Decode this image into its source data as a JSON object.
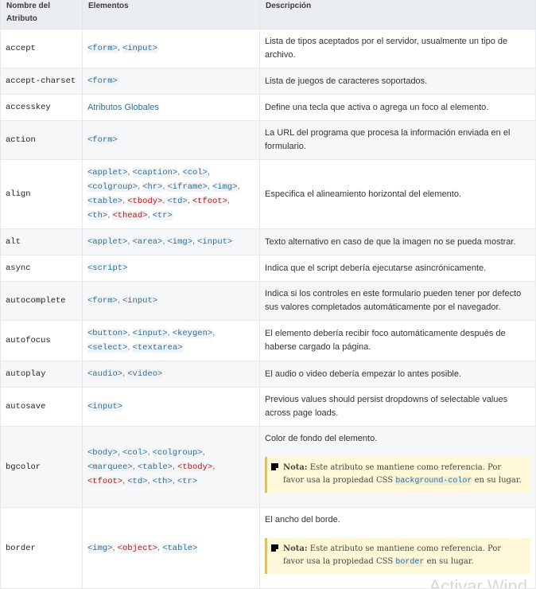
{
  "headers": [
    "Nombre del Atributo",
    "Elementos",
    "Descripción"
  ],
  "rows": [
    {
      "name": "accept",
      "elements": [
        {
          "text": "<form>"
        },
        {
          "text": "<input>"
        }
      ],
      "desc": "Lista de tipos aceptados por el servidor, usualmente un tipo de archivo."
    },
    {
      "name": "accept-charset",
      "elements": [
        {
          "text": "<form>"
        }
      ],
      "desc": "Lista de juegos de caracteres soportados."
    },
    {
      "name": "accesskey",
      "link": "Atributos Globales",
      "desc": "Define una tecla que activa o agrega un foco al elemento."
    },
    {
      "name": "action",
      "elements": [
        {
          "text": "<form>"
        }
      ],
      "desc": "La URL del programa que procesa la información enviada en el formulario."
    },
    {
      "name": "align",
      "elements": [
        {
          "text": "<applet>"
        },
        {
          "text": "<caption>"
        },
        {
          "text": "<col>"
        },
        {
          "text": "<colgroup>"
        },
        {
          "text": "<hr>"
        },
        {
          "text": "<iframe>"
        },
        {
          "text": "<img>"
        },
        {
          "text": "<table>"
        },
        {
          "text": "<tbody>",
          "deprecated": true
        },
        {
          "text": "<td>"
        },
        {
          "text": "<tfoot>",
          "deprecated": true
        },
        {
          "text": "<th>"
        },
        {
          "text": "<thead>",
          "deprecated": true
        },
        {
          "text": "<tr>"
        }
      ],
      "desc": "Especifica el alineamiento horizontal del elemento."
    },
    {
      "name": "alt",
      "elements": [
        {
          "text": "<applet>"
        },
        {
          "text": "<area>"
        },
        {
          "text": "<img>"
        },
        {
          "text": "<input>"
        }
      ],
      "desc": "Texto alternativo en caso de que la imagen no se pueda mostrar."
    },
    {
      "name": "async",
      "elements": [
        {
          "text": "<script>"
        }
      ],
      "desc": "Indica que el script debería ejecutarse asincrónicamente."
    },
    {
      "name": "autocomplete",
      "elements": [
        {
          "text": "<form>"
        },
        {
          "text": "<input>"
        }
      ],
      "desc": "Indica si los controles en este formulario pueden tener por defecto sus valores completados automáticamente por el navegador."
    },
    {
      "name": "autofocus",
      "elements": [
        {
          "text": "<button>"
        },
        {
          "text": "<input>"
        },
        {
          "text": "<keygen>"
        },
        {
          "text": "<select>"
        },
        {
          "text": "<textarea>"
        }
      ],
      "desc": "El elemento debería recibir foco automáticamente después de haberse cargado la página."
    },
    {
      "name": "autoplay",
      "elements": [
        {
          "text": "<audio>"
        },
        {
          "text": "<video>"
        }
      ],
      "desc": "El audio o video debería empezar lo antes posible."
    },
    {
      "name": "autosave",
      "elements": [
        {
          "text": "<input>"
        }
      ],
      "desc": "Previous values should persist dropdowns of selectable values across page loads."
    },
    {
      "name": "bgcolor",
      "elements": [
        {
          "text": "<body>"
        },
        {
          "text": "<col>"
        },
        {
          "text": "<colgroup>"
        },
        {
          "text": "<marquee>"
        },
        {
          "text": "<table>"
        },
        {
          "text": "<tbody>",
          "deprecated": true
        },
        {
          "text": "<tfoot>",
          "deprecated": true
        },
        {
          "text": "<td>"
        },
        {
          "text": "<th>"
        },
        {
          "text": "<tr>"
        }
      ],
      "desc": "Color de fondo del elemento.",
      "note": {
        "label": "Nota:",
        "before": "Este atributo se mantiene como referencia. Por favor usa la propiedad CSS",
        "code": "background-color",
        "after": "en su lugar."
      }
    },
    {
      "name": "border",
      "elements": [
        {
          "text": "<img>"
        },
        {
          "text": "<object>",
          "deprecated": true
        },
        {
          "text": "<table>"
        }
      ],
      "desc": "El ancho del borde.",
      "note": {
        "label": "Nota:",
        "before": "Este atributo se mantiene como referencia. Por favor usa la propiedad CSS",
        "code": "border",
        "after": "en su lugar."
      }
    }
  ],
  "watermark": "Activar Wind",
  "colors": {
    "tag": "#2f6f97",
    "deprecated": "#b01818",
    "note_bg": "#fff8d8",
    "note_border": "#f0c231",
    "header_bg": "#eaeef2"
  }
}
